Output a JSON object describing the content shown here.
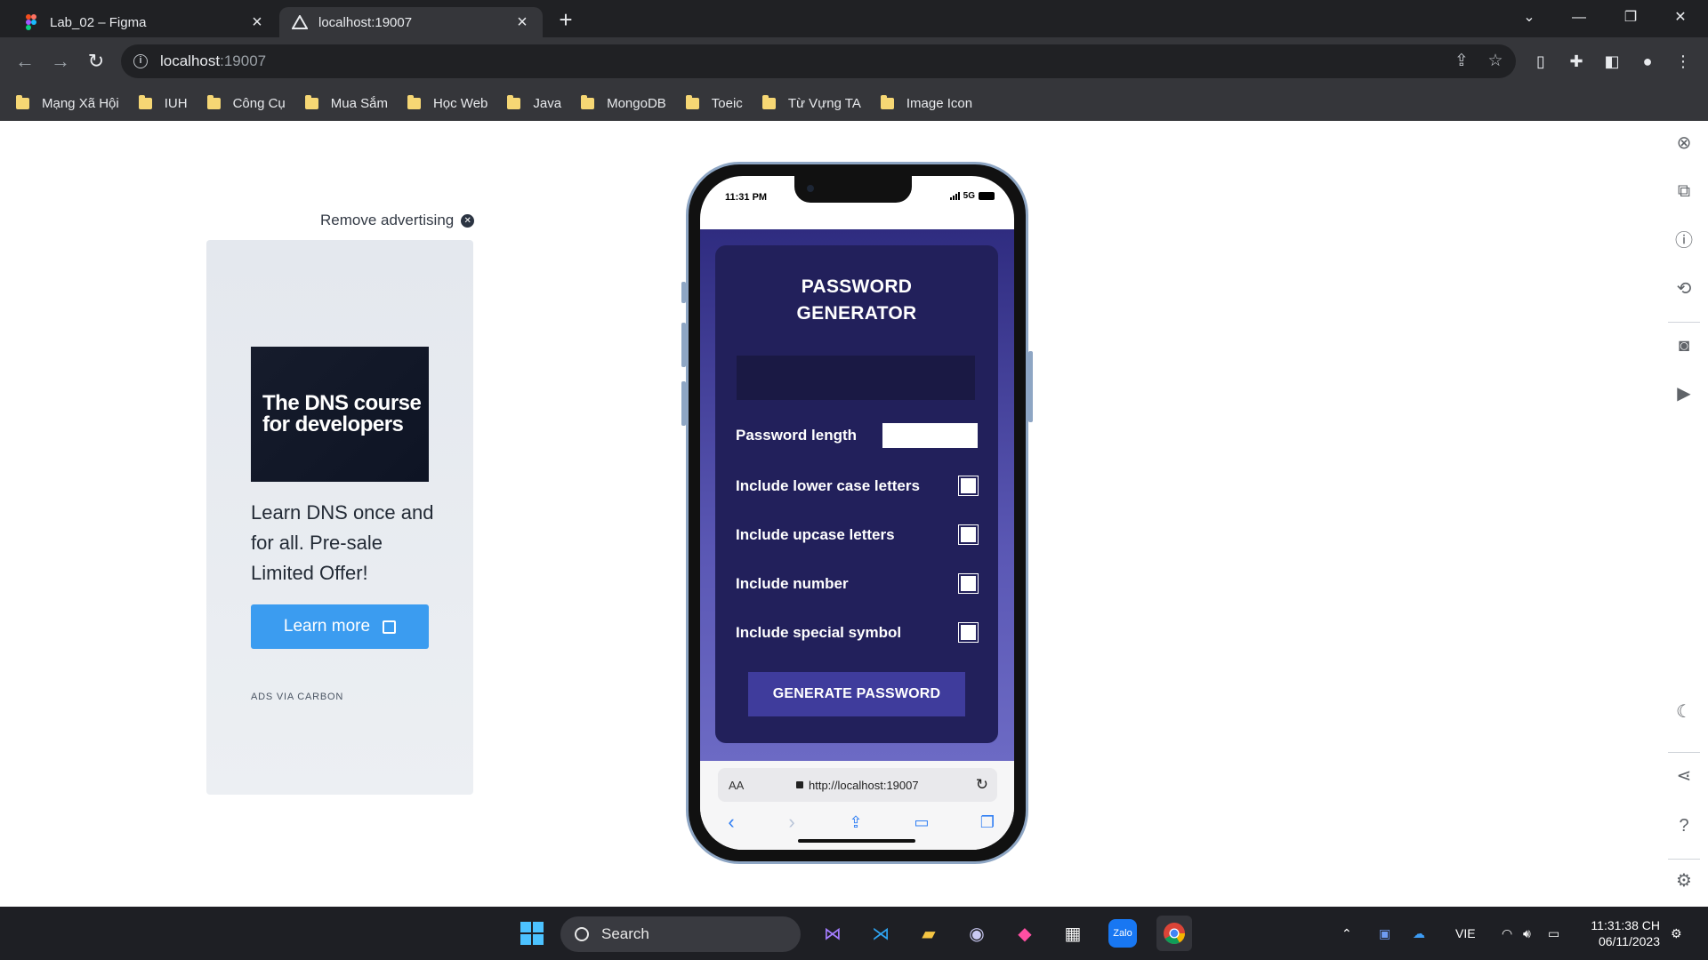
{
  "browser": {
    "tabs": [
      {
        "title": "Lab_02 – Figma",
        "active": false
      },
      {
        "title": "localhost:19007",
        "active": true
      }
    ],
    "url_host": "localhost",
    "url_port": ":19007",
    "bookmarks": [
      "Mạng Xã Hội",
      "IUH",
      "Công Cụ",
      "Mua Sắm",
      "Học Web",
      "Java",
      "MongoDB",
      "Toeic",
      "Từ Vựng TA",
      "Image Icon"
    ]
  },
  "ad": {
    "remove_label": "Remove advertising",
    "image_text": "The DNS course for developers",
    "body": "Learn DNS once and for all. Pre-sale Limited Offer!",
    "button": "Learn more",
    "via": "ADS VIA CARBON"
  },
  "phone": {
    "status_time": "11:31 PM",
    "network": "5G",
    "app": {
      "title_line1": "PASSWORD",
      "title_line2": "GENERATOR",
      "length_label": "Password length",
      "options": [
        "Include lower case letters",
        "Include upcase letters",
        "Include number",
        "Include special symbol"
      ],
      "generate_button": "GENERATE PASSWORD"
    },
    "safari": {
      "aa": "AA",
      "address": "http://localhost:19007"
    }
  },
  "taskbar": {
    "search_label": "Search",
    "language": "VIE",
    "time": "11:31:38 CH",
    "date": "06/11/2023"
  },
  "colors": {
    "card_bg": "#22205b",
    "app_gradient_top": "#2f2c80",
    "button_bg": "#3f3c9c",
    "ad_button": "#3b9cf0"
  }
}
